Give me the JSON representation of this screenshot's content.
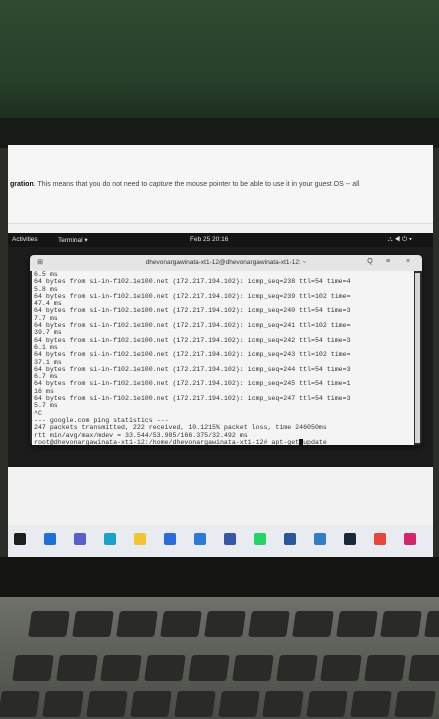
{
  "document": {
    "bold_word": "gration",
    "sentence": ". This means that you do not need to ",
    "italic_word": "capture",
    "sentence_tail": " the mouse pointer to be able to use it in your guest OS -- all"
  },
  "topbar": {
    "activities": "Activities",
    "app_menu": "Terminal ▾",
    "clock": "Feb 25  20:16",
    "status_icons": "⛬ ◀ ⏻ ▾"
  },
  "terminal": {
    "title": "dhevonargawinata-xt1-12@dhevonargawinata-xt1-12: ~",
    "search_glyph": "Q",
    "menu_glyph": "≡",
    "close_glyph": "×",
    "new_tab_glyph": "⊞",
    "lines": [
      "6.5 ms",
      "64 bytes from si-in-f102.1e100.net (172.217.194.102): icmp_seq=238 ttl=54 time=4",
      "5.8 ms",
      "64 bytes from si-in-f102.1e100.net (172.217.194.102): icmp_seq=239 ttl=102 time=",
      "47.4 ms",
      "64 bytes from si-in-f102.1e100.net (172.217.194.102): icmp_seq=240 ttl=54 time=3",
      "7.7 ms",
      "64 bytes from si-in-f102.1e100.net (172.217.194.102): icmp_seq=241 ttl=102 time=",
      "39.7 ms",
      "64 bytes from si-in-f102.1e100.net (172.217.194.102): icmp_seq=242 ttl=54 time=3",
      "6.1 ms",
      "64 bytes from si-in-f102.1e100.net (172.217.194.102): icmp_seq=243 ttl=102 time=",
      "37.1 ms",
      "64 bytes from si-in-f102.1e100.net (172.217.194.102): icmp_seq=244 ttl=54 time=3",
      "6.7 ms",
      "64 bytes from si-in-f102.1e100.net (172.217.194.102): icmp_seq=245 ttl=54 time=1",
      "16 ms",
      "64 bytes from si-in-f102.1e100.net (172.217.194.102): icmp_seq=247 ttl=54 time=3",
      "5.7 ms",
      "^C",
      "--- google.com ping statistics ---",
      "247 packets transmitted, 222 received, 10.1215% packet loss, time 246050ms",
      "rtt min/avg/max/mdev = 33.544/53.985/166.375/32.492 ms"
    ],
    "prompt": "root@dhevonargawinata-xt1-12:/home/dhevonargawinata-xt1-12# ",
    "command_before_cursor": "apt-get",
    "command_after_cursor": "update"
  },
  "taskbar": {
    "icons": [
      {
        "name": "start-icon",
        "color": "#1e1e1e"
      },
      {
        "name": "task-view-icon",
        "color": "#1f6fd6"
      },
      {
        "name": "meet-icon",
        "color": "#5b5fc7"
      },
      {
        "name": "edge-icon",
        "color": "#1aa1c9"
      },
      {
        "name": "file-explorer-icon",
        "color": "#f4c430"
      },
      {
        "name": "store-icon",
        "color": "#2b6ad8"
      },
      {
        "name": "mail-icon",
        "color": "#2a7ad6"
      },
      {
        "name": "virtualbox-icon",
        "color": "#3956a6"
      },
      {
        "name": "whatsapp-icon",
        "color": "#25d366"
      },
      {
        "name": "word-icon",
        "color": "#2b579a"
      },
      {
        "name": "photos-icon",
        "color": "#2f7ec5"
      },
      {
        "name": "steam-icon",
        "color": "#1b2838"
      },
      {
        "name": "chrome-icon",
        "color": "#e8453c"
      },
      {
        "name": "slack-icon",
        "color": "#d4246b"
      }
    ]
  }
}
